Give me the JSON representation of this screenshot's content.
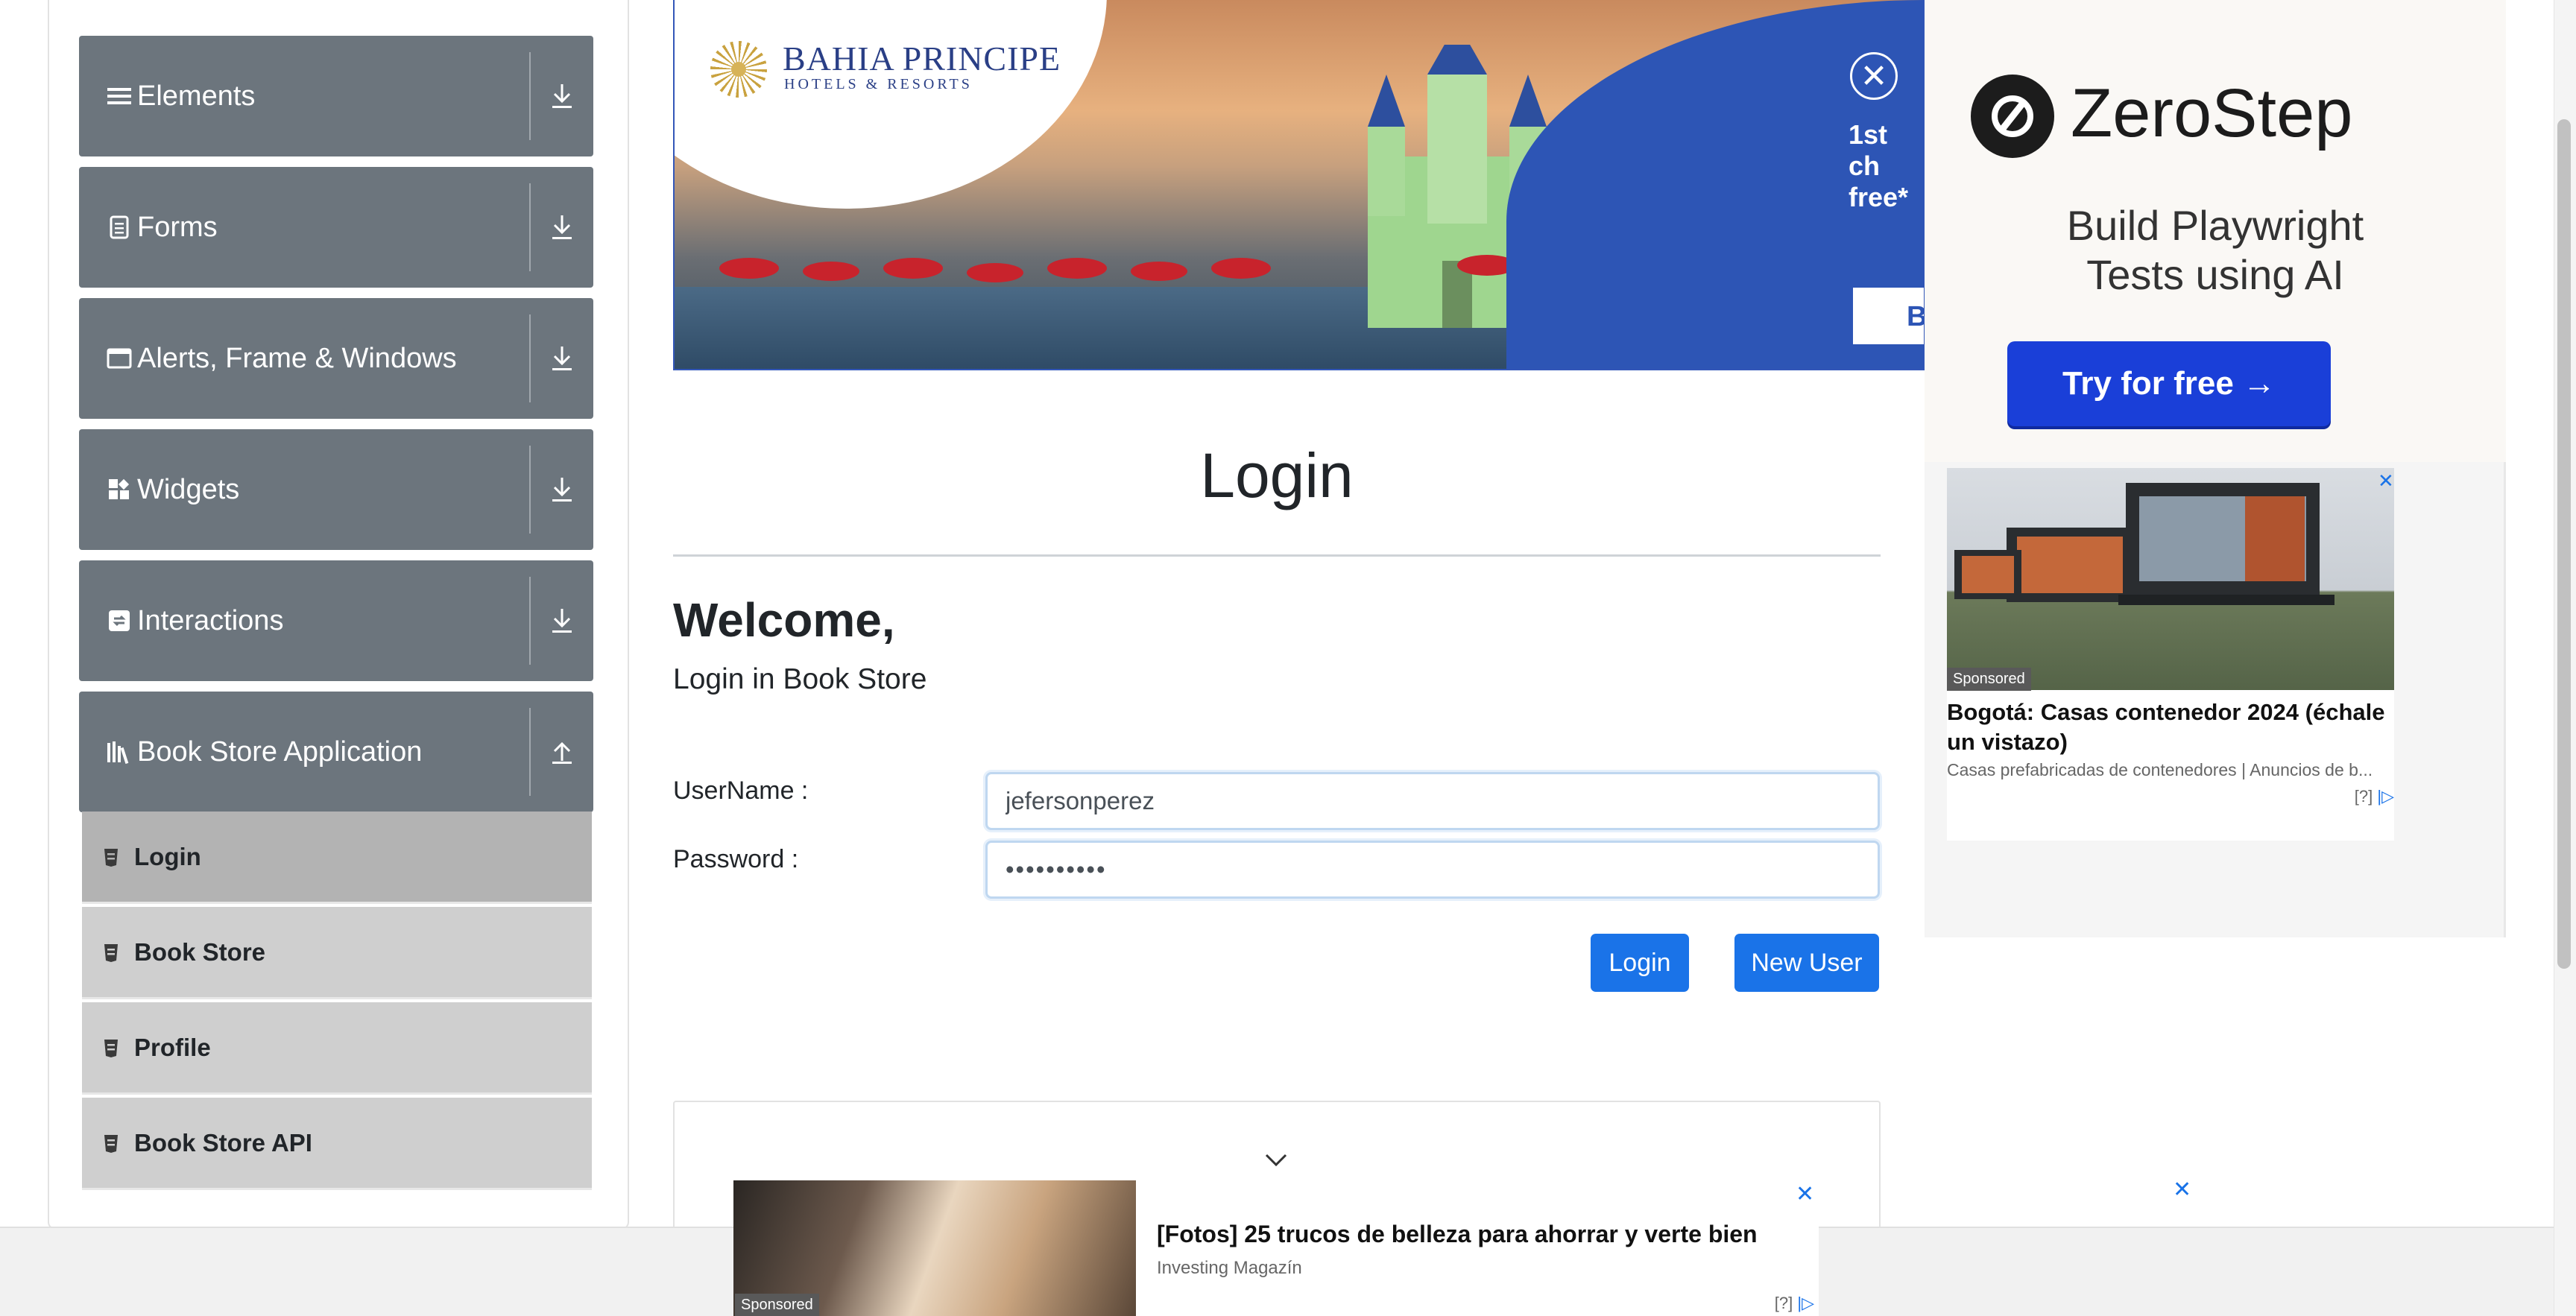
{
  "sidebar": {
    "groups": [
      {
        "label": "Elements",
        "icon": "hamburger-icon",
        "arrow": "download-arrow-icon"
      },
      {
        "label": "Forms",
        "icon": "document-icon",
        "arrow": "download-arrow-icon"
      },
      {
        "label": "Alerts, Frame & Windows",
        "icon": "window-icon",
        "arrow": "download-arrow-icon"
      },
      {
        "label": "Widgets",
        "icon": "grid-icon",
        "arrow": "download-arrow-icon"
      },
      {
        "label": "Interactions",
        "icon": "interaction-icon",
        "arrow": "download-arrow-icon"
      },
      {
        "label": "Book Store Application",
        "icon": "books-icon",
        "arrow": "upload-arrow-icon"
      }
    ],
    "book_store_items": [
      {
        "label": "Login",
        "active": true
      },
      {
        "label": "Book Store",
        "active": false
      },
      {
        "label": "Profile",
        "active": false
      },
      {
        "label": "Book Store API",
        "active": false
      }
    ]
  },
  "banner": {
    "brand": "BAHIA PRINCIPE",
    "brand_sub": "HOTELS & RESORTS",
    "promo_line1": "1st ch",
    "promo_line2": "free*",
    "promo_button": "B",
    "close_glyph": "✕"
  },
  "main": {
    "title": "Login",
    "welcome": "Welcome,",
    "subtitle": "Login in Book Store",
    "username_label": "UserName :",
    "username_value": "jefersonperez",
    "password_label": "Password :",
    "password_value": "••••••••••",
    "login_button": "Login",
    "new_user_button": "New User"
  },
  "right_ad": {
    "brand": "ZeroStep",
    "headline_line1": "Build Playwright",
    "headline_line2": "Tests using AI",
    "cta": "Try for free →",
    "sponsored_tag": "Sponsored",
    "sponsored_title": "Bogotá: Casas contenedor 2024 (échale un vistazo)",
    "sponsored_sub": "Casas prefabricadas de contenedores | Anuncios de b...",
    "ad_choices": "[?]",
    "close_glyph": "✕"
  },
  "sticky_ad": {
    "tag": "Sponsored",
    "title": "[Fotos] 25 trucos de belleza para ahorrar y verte bien",
    "source": "Investing Magazín",
    "ad_choices": "[?]",
    "close_glyph": "✕"
  },
  "colors": {
    "sidebar_group_bg": "#6c757d",
    "sub_item_bg": "#cfcfcf",
    "sub_item_active_bg": "#b3b3b3",
    "primary_button": "#1a73e8",
    "zerostep_button": "#1a3fd8"
  }
}
